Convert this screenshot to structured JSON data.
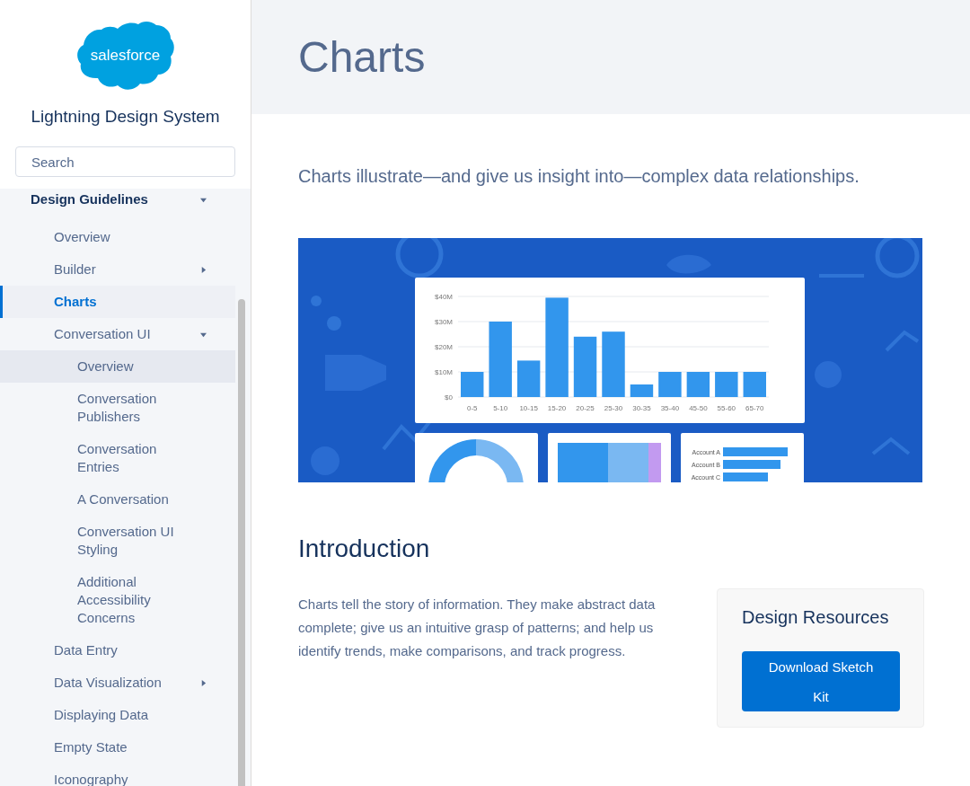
{
  "sidebar": {
    "brand": "salesforce",
    "title": "Lightning Design System",
    "search": {
      "placeholder": "Search"
    },
    "nav": [
      {
        "label": "Design Guidelines",
        "selected": false,
        "hovered": false,
        "expanded": true,
        "children": [
          {
            "label": "Overview",
            "selected": false,
            "hovered": false
          },
          {
            "label": "Builder",
            "selected": false,
            "hovered": false,
            "expanded": false
          },
          {
            "label": "Charts",
            "selected": true,
            "hovered": false
          },
          {
            "label": "Conversation UI",
            "selected": false,
            "hovered": false,
            "expanded": true,
            "children": [
              {
                "label": "Overview",
                "selected": false,
                "hovered": true
              },
              {
                "label": "Conversation Publishers",
                "selected": false,
                "hovered": false
              },
              {
                "label": "Conversation Entries",
                "selected": false,
                "hovered": false
              },
              {
                "label": "A Conversation",
                "selected": false,
                "hovered": false
              },
              {
                "label": "Conversation UI Styling",
                "selected": false,
                "hovered": false
              },
              {
                "label": "Additional Accessibility Concerns",
                "selected": false,
                "hovered": false
              }
            ]
          },
          {
            "label": "Data Entry",
            "selected": false,
            "hovered": false
          },
          {
            "label": "Data Visualization",
            "selected": false,
            "hovered": false,
            "expanded": false
          },
          {
            "label": "Displaying Data",
            "selected": false,
            "hovered": false
          },
          {
            "label": "Empty State",
            "selected": false,
            "hovered": false
          },
          {
            "label": "Iconography",
            "selected": false,
            "hovered": false
          }
        ]
      }
    ]
  },
  "page": {
    "title": "Charts",
    "lead": "Charts illustrate—and give us insight into—complex data relationships.",
    "hero": {
      "chart_data": {
        "type": "bar",
        "categories": [
          "0-5",
          "5-10",
          "10-15",
          "15-20",
          "20-25",
          "25-30",
          "30-35",
          "35-40",
          "45-50",
          "55-60",
          "65-70"
        ],
        "series": [
          {
            "color": "#3296ed",
            "values": [
              10,
              30,
              14.5,
              39.5,
              24,
              26,
              5,
              10,
              10,
              10,
              10
            ]
          }
        ],
        "ylim": [
          0,
          40
        ],
        "grid": true,
        "yticks": [
          {
            "value": 0,
            "label": "$0"
          },
          {
            "value": 10,
            "label": "$10M"
          },
          {
            "value": 20,
            "label": "$20M"
          },
          {
            "value": 30,
            "label": "$30M"
          },
          {
            "value": 40,
            "label": "$40M"
          }
        ]
      },
      "account_labels": [
        "Account A",
        "Account B",
        "Account C"
      ]
    },
    "intro": {
      "heading": "Introduction",
      "text": "Charts tell the story of information. They make abstract data complete; give us an intuitive grasp of patterns; and help us identify trends, make comparisons, and track progress."
    },
    "resources": {
      "title": "Design Resources",
      "button": "Download Sketch Kit"
    }
  }
}
